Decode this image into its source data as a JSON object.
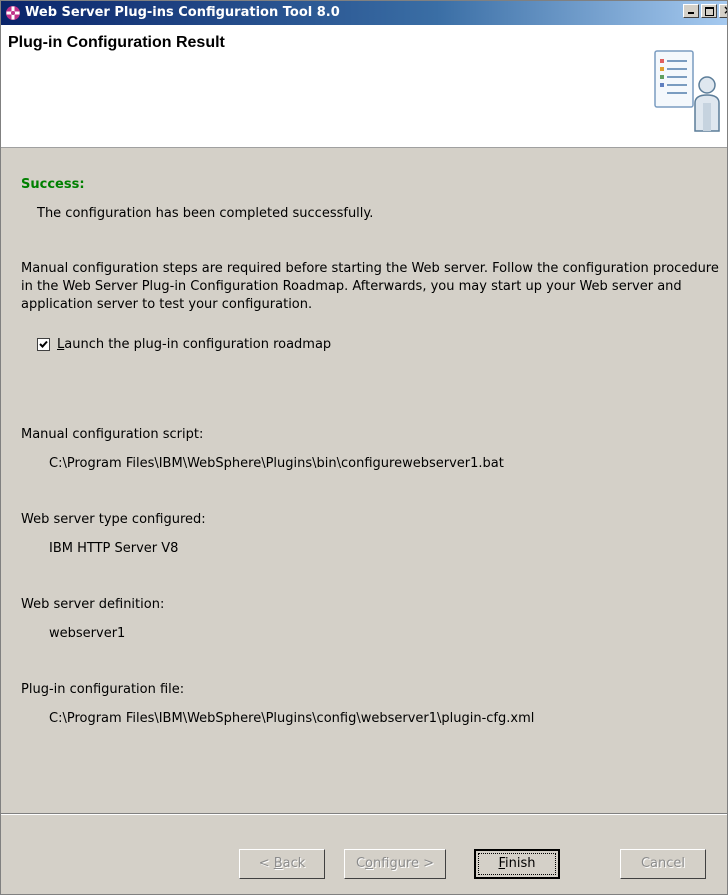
{
  "window": {
    "title": "Web Server Plug-ins Configuration Tool 8.0",
    "title_gradient": [
      "#0a246a",
      "#a6caf0"
    ]
  },
  "header": {
    "title": "Plug-in Configuration Result",
    "icon": "wizard-person-checklist-icon"
  },
  "content": {
    "success_label": "Success:",
    "success_message": "The configuration has been completed successfully.",
    "instructions": "Manual configuration steps are required before starting the Web server. Follow the configuration procedure in the Web Server Plug-in Configuration Roadmap. Afterwards, you may start up your Web server and application server to test your configuration.",
    "checkbox": {
      "checked": true,
      "label_mnemonic": "L",
      "label_rest": "aunch the plug-in configuration roadmap"
    },
    "fields": [
      {
        "label": "Manual configuration script:",
        "value": "C:\\Program Files\\IBM\\WebSphere\\Plugins\\bin\\configurewebserver1.bat"
      },
      {
        "label": "Web server type configured:",
        "value": "IBM HTTP Server V8"
      },
      {
        "label": "Web server definition:",
        "value": "webserver1"
      },
      {
        "label": "Plug-in configuration file:",
        "value": "C:\\Program Files\\IBM\\WebSphere\\Plugins\\config\\webserver1\\plugin-cfg.xml"
      }
    ],
    "success_color": "#008000"
  },
  "buttons": {
    "back": {
      "pre": "< ",
      "mnemonic": "B",
      "post": "ack",
      "enabled": false
    },
    "configure": {
      "pre": "C",
      "mnemonic": "o",
      "post": "nfigure >",
      "enabled": false
    },
    "finish": {
      "pre": "",
      "mnemonic": "F",
      "post": "inish",
      "enabled": true
    },
    "cancel": {
      "pre": "Cancel",
      "mnemonic": "",
      "post": "",
      "enabled": false
    }
  }
}
